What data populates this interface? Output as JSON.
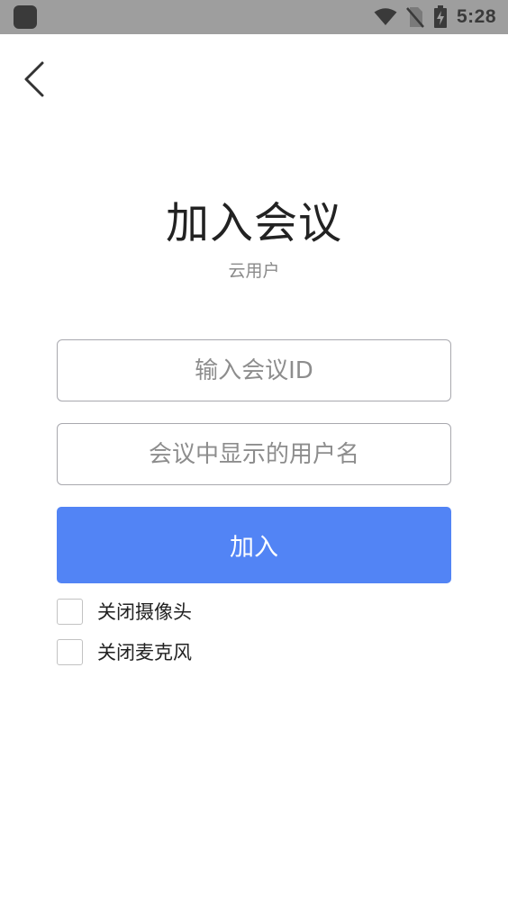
{
  "status_bar": {
    "time": "5:28",
    "icons": [
      "app-icon",
      "wifi-icon",
      "no-sim-icon",
      "battery-charging-icon"
    ]
  },
  "header": {
    "back_icon": "chevron-left-icon"
  },
  "title": "加入会议",
  "subtitle": "云用户",
  "form": {
    "meeting_id_placeholder": "输入会议ID",
    "meeting_id_value": "",
    "display_name_placeholder": "会议中显示的用户名",
    "display_name_value": "",
    "join_label": "加入"
  },
  "options": [
    {
      "label": "关闭摄像头",
      "checked": false
    },
    {
      "label": "关闭麦克风",
      "checked": false
    }
  ],
  "colors": {
    "status_bar_bg": "#9e9e9e",
    "primary_button": "#5284f5",
    "title_text": "#222222",
    "subtitle_text": "#8a8a8a"
  }
}
